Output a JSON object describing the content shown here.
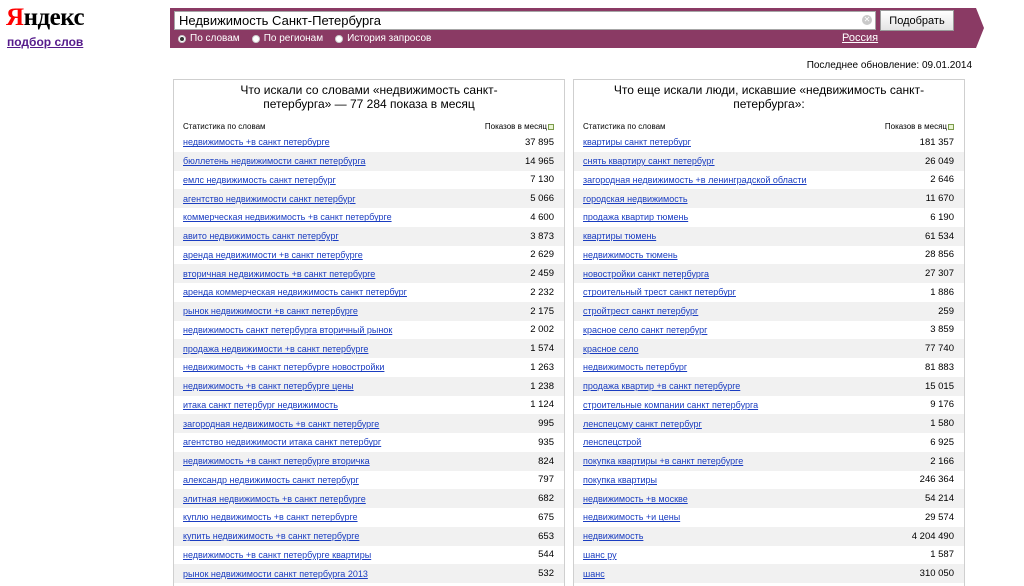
{
  "brand": {
    "logo_first": "Я",
    "logo_rest": "ндекс",
    "subtitle": "подбор слов"
  },
  "search": {
    "value": "Недвижимость Санкт-Петербурга",
    "button": "Подобрать",
    "modes": [
      "По словам",
      "По регионам",
      "История запросов"
    ],
    "selected_mode": "По словам",
    "region": "Россия"
  },
  "last_updated": "Последнее обновление: 09.01.2014",
  "left": {
    "title_line1": "Что искали со словами «недвижимость санкт-",
    "title_line2": "петербурга» — 77 284 показа в месяц",
    "col_stat": "Статистика по словам",
    "col_shows": "Показов в месяц",
    "rows": [
      {
        "q": "недвижимость +в санкт петербурге",
        "n": "37 895"
      },
      {
        "q": "бюллетень недвижимости санкт петербурга",
        "n": "14 965"
      },
      {
        "q": "емлс недвижимость санкт петербург",
        "n": "7 130"
      },
      {
        "q": "агентство недвижимости санкт петербург",
        "n": "5 066"
      },
      {
        "q": "коммерческая недвижимость +в санкт петербурге",
        "n": "4 600"
      },
      {
        "q": "авито недвижимость санкт петербург",
        "n": "3 873"
      },
      {
        "q": "аренда недвижимости +в санкт петербурге",
        "n": "2 629"
      },
      {
        "q": "вторичная недвижимость +в санкт петербурге",
        "n": "2 459"
      },
      {
        "q": "аренда коммерческая недвижимость санкт петербург",
        "n": "2 232"
      },
      {
        "q": "рынок недвижимости +в санкт петербурге",
        "n": "2 175"
      },
      {
        "q": "недвижимость санкт петербурга вторичный рынок",
        "n": "2 002"
      },
      {
        "q": "продажа недвижимости +в санкт петербурге",
        "n": "1 574"
      },
      {
        "q": "недвижимость +в санкт петербурге новостройки",
        "n": "1 263"
      },
      {
        "q": "недвижимость +в санкт петербурге цены",
        "n": "1 238"
      },
      {
        "q": "итака санкт петербург недвижимость",
        "n": "1 124"
      },
      {
        "q": "загородная недвижимость +в санкт петербурге",
        "n": "995"
      },
      {
        "q": "агентство недвижимости итака санкт петербург",
        "n": "935"
      },
      {
        "q": "недвижимость +в санкт петербурге вторичка",
        "n": "824"
      },
      {
        "q": "александр недвижимость санкт петербург",
        "n": "797"
      },
      {
        "q": "элитная недвижимость +в санкт петербурге",
        "n": "682"
      },
      {
        "q": "куплю недвижимость +в санкт петербурге",
        "n": "675"
      },
      {
        "q": "купить недвижимость +в санкт петербурге",
        "n": "653"
      },
      {
        "q": "недвижимость +в санкт петербурге квартиры",
        "n": "544"
      },
      {
        "q": "рынок недвижимости санкт петербурга 2013",
        "n": "532"
      }
    ]
  },
  "right": {
    "title_line1": "Что еще искали люди, искавшие «недвижимость санкт-",
    "title_line2": "петербурга»:",
    "col_stat": "Статистика по словам",
    "col_shows": "Показов в месяц",
    "rows": [
      {
        "q": "квартиры санкт петербург",
        "n": "181 357"
      },
      {
        "q": "снять квартиру санкт петербург",
        "n": "26 049"
      },
      {
        "q": "загородная недвижимость +в ленинградской области",
        "n": "2 646"
      },
      {
        "q": "городская недвижимость",
        "n": "11 670"
      },
      {
        "q": "продажа квартир тюмень",
        "n": "6 190"
      },
      {
        "q": "квартиры тюмень",
        "n": "61 534"
      },
      {
        "q": "недвижимость тюмень",
        "n": "28 856"
      },
      {
        "q": "новостройки санкт петербурга",
        "n": "27 307"
      },
      {
        "q": "строительный трест санкт петербург",
        "n": "1 886"
      },
      {
        "q": "стройтрест санкт петербург",
        "n": "259"
      },
      {
        "q": "красное село санкт петербург",
        "n": "3 859"
      },
      {
        "q": "красное село",
        "n": "77 740"
      },
      {
        "q": "недвижимость петербург",
        "n": "81 883"
      },
      {
        "q": "продажа квартир +в санкт петербурге",
        "n": "15 015"
      },
      {
        "q": "строительные компании санкт петербурга",
        "n": "9 176"
      },
      {
        "q": "ленспецсму санкт петербург",
        "n": "1 580"
      },
      {
        "q": "ленспецстрой",
        "n": "6 925"
      },
      {
        "q": "покупка квартиры +в санкт петербурге",
        "n": "2 166"
      },
      {
        "q": "покупка квартиры",
        "n": "246 364"
      },
      {
        "q": "недвижимость +в москве",
        "n": "54 214"
      },
      {
        "q": "недвижимость +и цены",
        "n": "29 574"
      },
      {
        "q": "недвижимость",
        "n": "4 204 490"
      },
      {
        "q": "шанс ру",
        "n": "1 587"
      },
      {
        "q": "шанс",
        "n": "310 050"
      }
    ]
  }
}
